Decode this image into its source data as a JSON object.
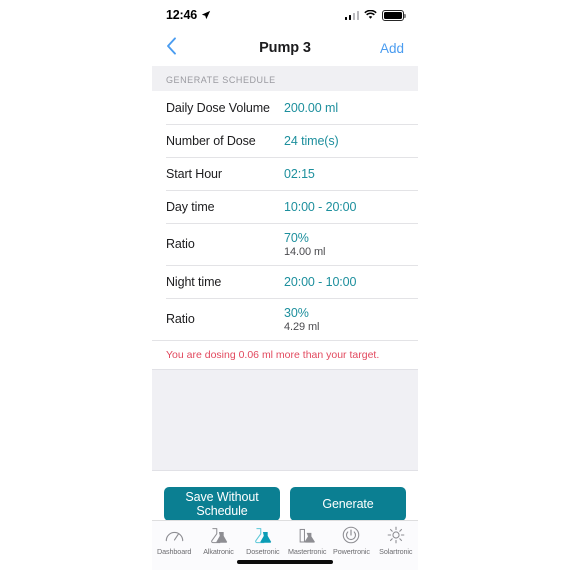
{
  "status_bar": {
    "time": "12:46",
    "location_icon": "location-arrow-icon",
    "signal_icon": "cellular-signal-icon",
    "wifi_icon": "wifi-icon",
    "battery_icon": "battery-full-icon"
  },
  "nav": {
    "back_icon": "chevron-left-icon",
    "title": "Pump 3",
    "action_label": "Add"
  },
  "section": {
    "header": "GENERATE SCHEDULE"
  },
  "rows": [
    {
      "label": "Daily Dose Volume",
      "value": "200.00 ml",
      "sub": ""
    },
    {
      "label": "Number of Dose",
      "value": "24 time(s)",
      "sub": ""
    },
    {
      "label": "Start Hour",
      "value": "02:15",
      "sub": ""
    },
    {
      "label": "Day time",
      "value": "10:00 - 20:00",
      "sub": ""
    },
    {
      "label": "Ratio",
      "value": "70%",
      "sub": "14.00 ml"
    },
    {
      "label": "Night time",
      "value": "20:00 - 10:00",
      "sub": ""
    },
    {
      "label": "Ratio",
      "value": "30%",
      "sub": "4.29 ml"
    }
  ],
  "warning": {
    "text": "You are dosing 0.06 ml more than your target.",
    "color": "#e2495e"
  },
  "actions": {
    "save_label": "Save Without Schedule",
    "generate_label": "Generate",
    "color": "#0b7f92"
  },
  "tabbar": {
    "items": [
      {
        "label": "Dashboard",
        "icon": "gauge-icon",
        "active": false
      },
      {
        "label": "Alkatronic",
        "icon": "flask-icon",
        "active": false
      },
      {
        "label": "Dosetronic",
        "icon": "flask-filled-icon",
        "active": true
      },
      {
        "label": "Mastertronic",
        "icon": "beaker-icon",
        "active": false
      },
      {
        "label": "Powertronic",
        "icon": "power-icon",
        "active": false
      },
      {
        "label": "Solartronic",
        "icon": "sun-icon",
        "active": false
      }
    ]
  },
  "theme": {
    "accent_teal": "#1d8f9d",
    "button_teal": "#0b7f92",
    "link_blue": "#4a9cf0",
    "warning_red": "#e2495e",
    "panel_gray": "#f0f0f4"
  }
}
